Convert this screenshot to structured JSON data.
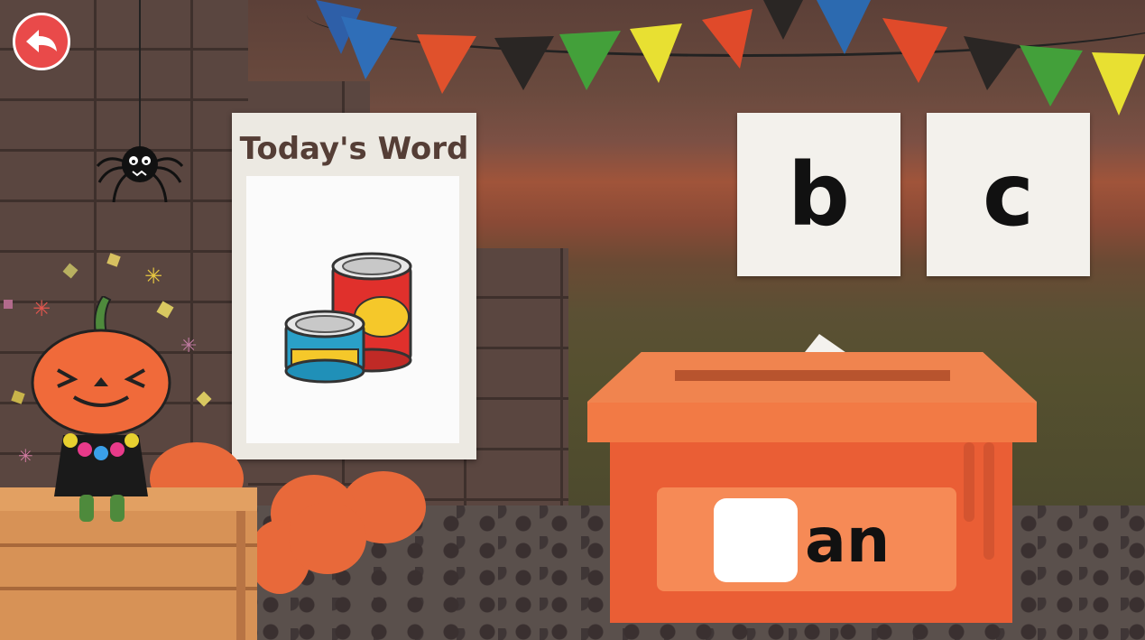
{
  "poster": {
    "title": "Today's Word",
    "image_icon": "cans-icon"
  },
  "choices": [
    "b",
    "c"
  ],
  "answer_box": {
    "word_ending": "an",
    "blank_value": ""
  },
  "icons": {
    "back": "back-arrow-icon",
    "spider": "spider-icon",
    "character": "pumpkin-character-icon"
  },
  "colors": {
    "back_button": "#e94a4a",
    "box": "#ea5e35",
    "box_panel": "#f68a56",
    "poster_title": "#553e36"
  }
}
